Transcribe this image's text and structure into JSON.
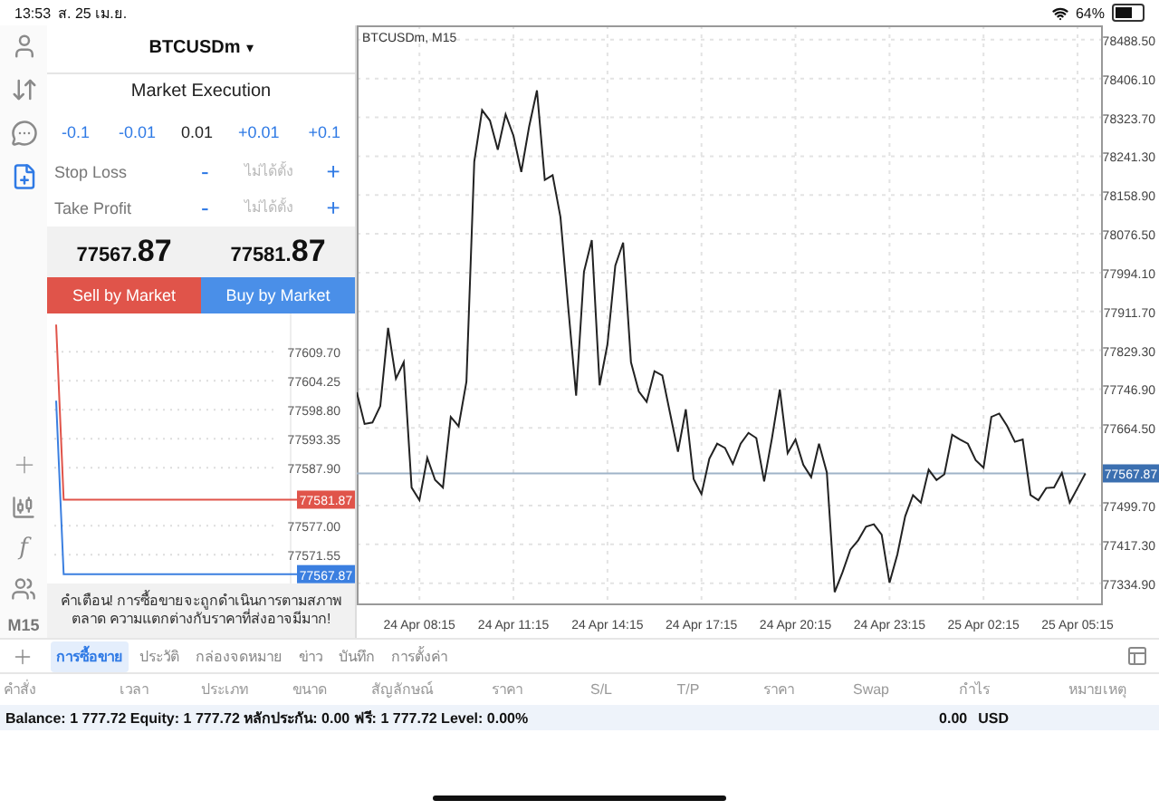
{
  "status_bar": {
    "time": "13:53",
    "date": "ส. 25 เม.ย.",
    "battery_text": "64%"
  },
  "toolbar": {
    "top": [
      {
        "selected": false
      },
      {
        "selected": false
      },
      {
        "selected": false
      },
      {
        "selected": true
      }
    ],
    "indicator_symbol": "f",
    "timeframe": "M15"
  },
  "order_panel": {
    "symbol": "BTCUSDm",
    "dropdown_caret": "▾",
    "execution": "Market Execution",
    "volume_steps": [
      "-0.1",
      "-0.01",
      "+0.01",
      "+0.1"
    ],
    "volume": "0.01",
    "stop_loss": {
      "label": "Stop Loss",
      "minus": "-",
      "placeholder": "ไม่ได้ตั้ง",
      "plus": "+"
    },
    "take_profit": {
      "label": "Take Profit",
      "minus": "-",
      "placeholder": "ไม่ได้ตั้ง",
      "plus": "+"
    },
    "bid": {
      "main": "77567.",
      "pips": "87"
    },
    "ask": {
      "main": "77581.",
      "pips": "87"
    },
    "sell_button": "Sell by Market",
    "buy_button": "Buy by Market",
    "tick_chart": {
      "price_tags": [
        {
          "label": "77581.87"
        },
        {
          "label": "77567.87"
        }
      ],
      "chart_data": {
        "type": "line",
        "grid": true,
        "ylim": [
          77565.8,
          77616.9
        ],
        "categories": [
          null,
          null,
          null,
          null,
          null,
          null,
          null,
          null,
          null,
          null,
          null,
          null,
          null,
          null,
          null,
          null,
          null,
          null,
          null,
          null,
          null,
          null,
          null,
          null,
          null,
          null,
          null,
          null,
          null,
          null,
          null,
          null,
          null
        ],
        "yticks": [
          {
            "value": 77609.7,
            "label": "77609.70"
          },
          {
            "value": 77604.25,
            "label": "77604.25"
          },
          {
            "value": 77598.8,
            "label": "77598.80"
          },
          {
            "value": 77593.35,
            "label": "77593.35"
          },
          {
            "value": 77587.9,
            "label": "77587.90"
          },
          {
            "value": 77577.0,
            "label": "77577.00"
          },
          {
            "value": 77571.55,
            "label": "77571.55"
          }
        ],
        "series": [
          {
            "color": "#e0544a",
            "values": [
              77614.8,
              77581.9,
              77581.9,
              77581.9,
              77581.9,
              77581.9,
              77581.9,
              77581.9,
              77581.9,
              77581.9,
              77581.9,
              77581.9,
              77581.9,
              77581.9,
              77581.9,
              77581.9,
              77581.9,
              77581.9,
              77581.9,
              77581.9,
              77581.9,
              77581.9,
              77581.9,
              77581.9,
              77581.9,
              77581.9,
              77581.9,
              77581.9,
              77581.9,
              77581.9,
              77581.9,
              77581.9,
              77581.9
            ]
          },
          {
            "color": "#3b7fe0",
            "values": [
              77600.5,
              77567.9,
              77567.9,
              77567.9,
              77567.9,
              77567.9,
              77567.9,
              77567.9,
              77567.9,
              77567.9,
              77567.9,
              77567.9,
              77567.9,
              77567.9,
              77567.9,
              77567.9,
              77567.9,
              77567.9,
              77567.9,
              77567.9,
              77567.9,
              77567.9,
              77567.9,
              77567.9,
              77567.9,
              77567.9,
              77567.9,
              77567.9,
              77567.9,
              77567.9,
              77567.9,
              77567.9,
              77567.9
            ]
          }
        ]
      }
    },
    "warning": "คำเตือน! การซื้อขายจะถูกดำเนินการตามสภาพตลาด ความแตกต่างกับราคาที่ส่งอาจมีมาก!"
  },
  "chart": {
    "price_tag": {
      "label": "77567.87"
    },
    "chart_data": {
      "type": "line",
      "title": "BTCUSDm, M15",
      "grid": true,
      "ylim": [
        77292,
        78519
      ],
      "categories": [
        null,
        null,
        null,
        null,
        null,
        null,
        null,
        null,
        "24 Apr 08:15",
        null,
        null,
        null,
        null,
        null,
        null,
        null,
        null,
        null,
        null,
        null,
        "24 Apr 11:15",
        null,
        null,
        null,
        null,
        null,
        null,
        null,
        null,
        null,
        null,
        null,
        "24 Apr 14:15",
        null,
        null,
        null,
        null,
        null,
        null,
        null,
        null,
        null,
        null,
        null,
        "24 Apr 17:15",
        null,
        null,
        null,
        null,
        null,
        null,
        null,
        null,
        null,
        null,
        null,
        "24 Apr 20:15",
        null,
        null,
        null,
        null,
        null,
        null,
        null,
        null,
        null,
        null,
        null,
        "24 Apr 23:15",
        null,
        null,
        null,
        null,
        null,
        null,
        null,
        null,
        null,
        null,
        null,
        "25 Apr 02:15",
        null,
        null,
        null,
        null,
        null,
        null,
        null,
        null,
        null,
        null,
        null,
        "25 Apr 05:15",
        null
      ],
      "series": [
        {
          "color": "#222222",
          "values": [
            77740,
            77673,
            77676,
            77711,
            77877,
            77769,
            77804,
            77538,
            77511,
            77601,
            77554,
            77538,
            77688,
            77668,
            77763,
            78230,
            78339,
            78317,
            78255,
            78330,
            78285,
            78208,
            78304,
            78381,
            78191,
            78201,
            78112,
            77919,
            77733,
            77996,
            78063,
            77755,
            77842,
            78009,
            78058,
            77804,
            77742,
            77720,
            77785,
            77776,
            77695,
            77614,
            77704,
            77556,
            77524,
            77599,
            77631,
            77622,
            77588,
            77631,
            77654,
            77643,
            77551,
            77643,
            77746,
            77611,
            77640,
            77586,
            77560,
            77631,
            77570,
            77316,
            77358,
            77406,
            77426,
            77455,
            77460,
            77438,
            77336,
            77396,
            77477,
            77522,
            77506,
            77576,
            77554,
            77566,
            77650,
            77640,
            77631,
            77596,
            77580,
            77688,
            77695,
            77669,
            77635,
            77640,
            77522,
            77511,
            77537,
            77538,
            77569,
            77506,
            77537,
            77568
          ]
        },
        {
          "color": "#9fb3c8",
          "values": [
            77568,
            77568,
            77568,
            77568,
            77568,
            77568,
            77568,
            77568,
            77568,
            77568,
            77568,
            77568,
            77568,
            77568,
            77568,
            77568,
            77568,
            77568,
            77568,
            77568,
            77568,
            77568,
            77568,
            77568,
            77568,
            77568,
            77568,
            77568,
            77568,
            77568,
            77568,
            77568,
            77568,
            77568,
            77568,
            77568,
            77568,
            77568,
            77568,
            77568,
            77568,
            77568,
            77568,
            77568,
            77568,
            77568,
            77568,
            77568,
            77568,
            77568,
            77568,
            77568,
            77568,
            77568,
            77568,
            77568,
            77568,
            77568,
            77568,
            77568,
            77568,
            77568,
            77568,
            77568,
            77568,
            77568,
            77568,
            77568,
            77568,
            77568,
            77568,
            77568,
            77568,
            77568,
            77568,
            77568,
            77568,
            77568,
            77568,
            77568,
            77568,
            77568,
            77568,
            77568,
            77568,
            77568,
            77568,
            77568,
            77568,
            77568,
            77568,
            77568,
            77568,
            77568
          ]
        }
      ],
      "yticks": [
        {
          "value": 78488.5,
          "label": "78488.50"
        },
        {
          "value": 78406.1,
          "label": "78406.10"
        },
        {
          "value": 78323.7,
          "label": "78323.70"
        },
        {
          "value": 78241.3,
          "label": "78241.30"
        },
        {
          "value": 78158.9,
          "label": "78158.90"
        },
        {
          "value": 78076.5,
          "label": "78076.50"
        },
        {
          "value": 77994.1,
          "label": "77994.10"
        },
        {
          "value": 77911.7,
          "label": "77911.70"
        },
        {
          "value": 77829.3,
          "label": "77829.30"
        },
        {
          "value": 77746.9,
          "label": "77746.90"
        },
        {
          "value": 77664.5,
          "label": "77664.50"
        },
        {
          "value": 77499.7,
          "label": "77499.70"
        },
        {
          "value": 77417.3,
          "label": "77417.30"
        },
        {
          "value": 77334.9,
          "label": "77334.90"
        }
      ]
    }
  },
  "bottom_tabs": [
    {
      "label": "การซื้อขาย",
      "selected": true
    },
    {
      "label": "ประวัติ",
      "selected": false
    },
    {
      "label": "กล่องจดหมาย",
      "selected": false
    },
    {
      "label": "ข่าว",
      "selected": false
    },
    {
      "label": "บันทึก",
      "selected": false
    },
    {
      "label": "การตั้งค่า",
      "selected": false
    }
  ],
  "table": {
    "columns": [
      "คำสั่ง",
      "เวลา",
      "ประเภท",
      "ขนาด",
      "สัญลักษณ์",
      "ราคา",
      "S/L",
      "T/P",
      "ราคา",
      "Swap",
      "กำไร",
      "หมายเหตุ"
    ],
    "summary": {
      "text": "Balance: 1 777.72 Equity: 1 777.72 หลักประกัน: 0.00 ฟรี: 1 777.72 Level: 0.00%",
      "profit": "0.00",
      "currency": "USD"
    }
  }
}
